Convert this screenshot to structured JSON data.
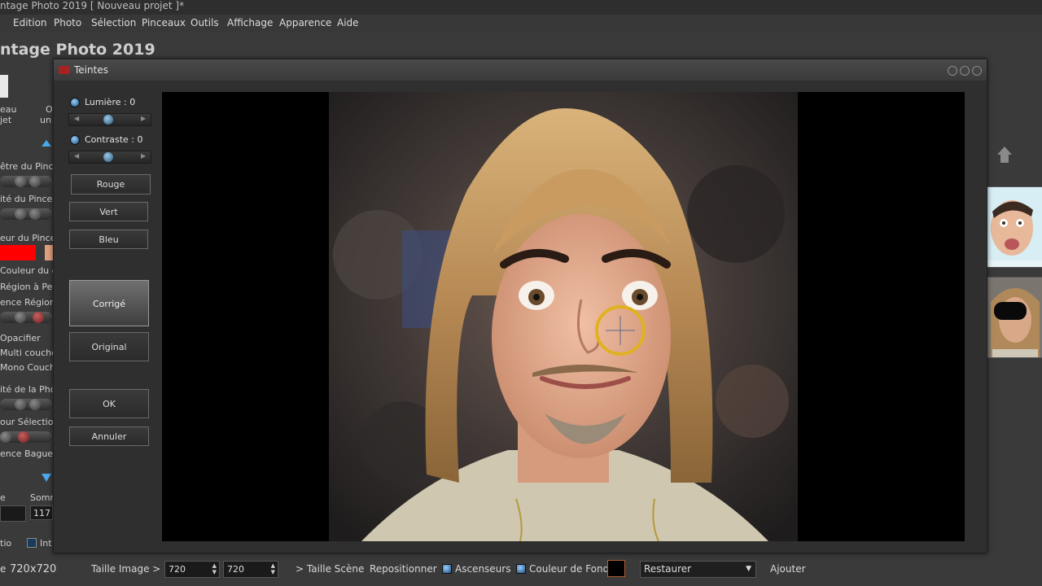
{
  "window": {
    "title": "ntage Photo 2019 [ Nouveau projet ]*"
  },
  "menu": [
    "Edition",
    "Photo",
    "Sélection",
    "Pinceaux",
    "Outils",
    "Affichage",
    "Apparence",
    "Aide"
  ],
  "app": {
    "title": "ntage Photo 2019"
  },
  "left_panel": {
    "toolbar": [
      "eau",
      "jet",
      "O",
      "un"
    ],
    "labels": [
      "être du Pince",
      "ité du Pinceau",
      "eur du Pincea",
      "Couleur du clic",
      "Région à Peinc",
      "ence Région",
      "Opacifier",
      "Multi couche",
      "Mono Couche",
      "ité de la Phot",
      "our Sélection",
      "ence Baguett",
      "e",
      "Somm",
      "tio",
      "Int"
    ],
    "somme_value": "117",
    "colors": {
      "brush": "#ff0000",
      "swatch2": "#e0a080"
    }
  },
  "dialog": {
    "title": "Teintes",
    "lumiere_label": "Lumière : 0",
    "contraste_label": "Contraste : 0",
    "buttons": {
      "rouge": "Rouge",
      "vert": "Vert",
      "bleu": "Bleu",
      "corrige": "Corrigé",
      "original": "Original",
      "ok": "OK",
      "annuler": "Annuler"
    }
  },
  "bottom": {
    "size_readout": "720x720",
    "taille_image_label": "Taille Image >",
    "width_value": "720",
    "height_value": "720",
    "taille_scene": "> Taille Scène",
    "repositionner": "Repositionner",
    "ascenseurs": "Ascenseurs",
    "couleur_de_fond": "Couleur de Fond",
    "restaurer": "Restaurer",
    "ajouter": "Ajouter"
  },
  "colors": {
    "background_swatch": "#000000"
  }
}
